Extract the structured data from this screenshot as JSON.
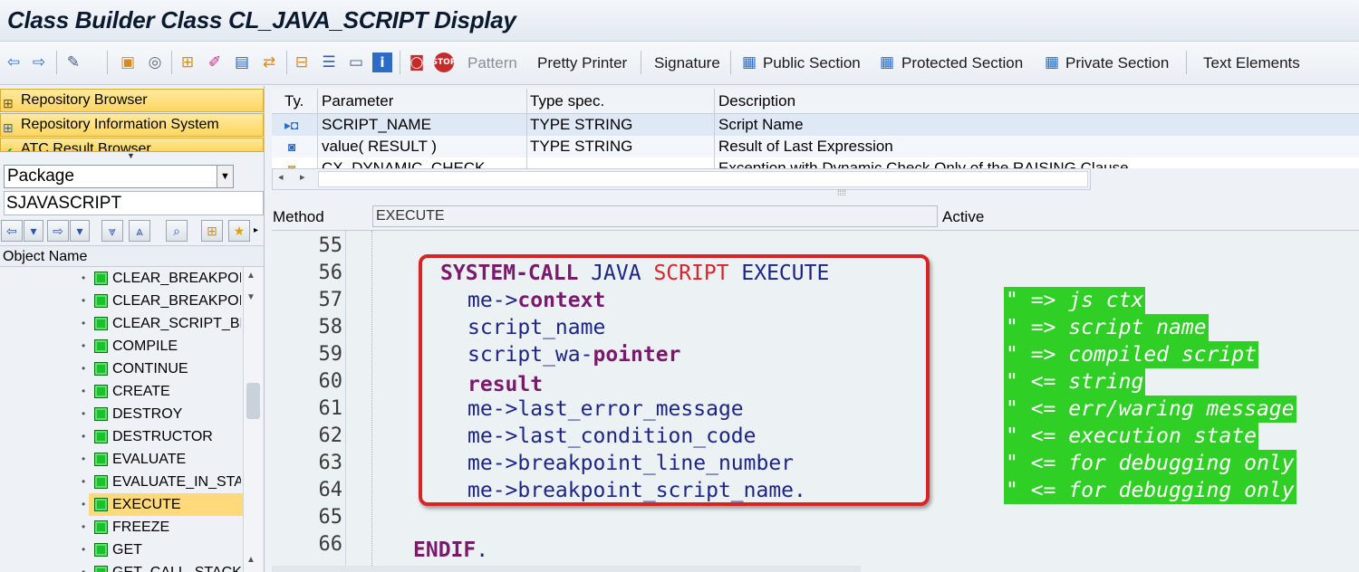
{
  "window": {
    "title": "Class Builder Class CL_JAVA_SCRIPT Display"
  },
  "toolbar": {
    "icons": [
      "back-icon",
      "forward-icon",
      "other-object-icon",
      "display-change-icon",
      "activate-icon",
      "check-icon",
      "where-used-icon",
      "object-list-icon",
      "navigation-window-icon",
      "local-types-icon",
      "info-icon",
      "set-breakpoint-icon",
      "stop-icon"
    ],
    "pattern_label": "Pattern",
    "pretty_printer_label": "Pretty Printer",
    "signature_label": "Signature",
    "public_section_label": "Public Section",
    "protected_section_label": "Protected Section",
    "private_section_label": "Private Section",
    "text_elements_label": "Text Elements"
  },
  "nav": {
    "buttons": [
      {
        "label": "Repository Browser"
      },
      {
        "label": "Repository Information System"
      },
      {
        "label": "ATC Result Browser"
      }
    ],
    "package_select": "Package",
    "package_value": "SJAVASCRIPT",
    "object_name_header": "Object Name",
    "tree_items": [
      {
        "label": "CLEAR_BREAKPOINT"
      },
      {
        "label": "CLEAR_BREAKPOINTS"
      },
      {
        "label": "CLEAR_SCRIPT_BREAKPOINTS"
      },
      {
        "label": "COMPILE"
      },
      {
        "label": "CONTINUE"
      },
      {
        "label": "CREATE"
      },
      {
        "label": "DESTROY"
      },
      {
        "label": "DESTRUCTOR"
      },
      {
        "label": "EVALUATE"
      },
      {
        "label": "EVALUATE_IN_STACK"
      },
      {
        "label": "EXECUTE"
      },
      {
        "label": "FREEZE"
      },
      {
        "label": "GET"
      },
      {
        "label": "GET_CALL_STACK"
      }
    ],
    "selected_item": "EXECUTE"
  },
  "params": {
    "headers": {
      "type": "Ty.",
      "parameter": "Parameter",
      "type_spec": "Type spec.",
      "description": "Description"
    },
    "rows": [
      {
        "parameter": "SCRIPT_NAME",
        "type_spec": "TYPE STRING",
        "description": "Script Name"
      },
      {
        "parameter": "value( RESULT )",
        "type_spec": "TYPE STRING",
        "description": "Result of Last Expression"
      },
      {
        "parameter": "CX_DYNAMIC_CHECK",
        "type_spec": "",
        "description": "Exception with Dynamic Check Only of the RAISING Clause"
      }
    ]
  },
  "method": {
    "label": "Method",
    "name": "EXECUTE",
    "status": "Active"
  },
  "editor": {
    "line_numbers": [
      "55",
      "56",
      "57",
      "58",
      "59",
      "60",
      "61",
      "62",
      "63",
      "64",
      "65",
      "66"
    ],
    "lines": {
      "l56_kw": "SYSTEM-CALL",
      "l56_java": "JAVA",
      "l56_script": "SCRIPT",
      "l56_execute": "EXECUTE",
      "l57_prefix": "me->",
      "l57_kw": "context",
      "l58": "script_name",
      "l59_prefix": "script_wa-",
      "l59_kw": "pointer",
      "l60_kw": "result",
      "l61": "me->last_error_message",
      "l62": "me->last_condition_code",
      "l63": "me->breakpoint_line_number",
      "l64": "me->breakpoint_script_name.",
      "l66_kw": "ENDIF",
      "l66_dot": "."
    },
    "comments": [
      "\" => js ctx",
      "\" => script name",
      "\" => compiled script",
      "\" <= string",
      "\" <= err/waring message",
      "\" <= execution state",
      "\" <= for debugging only",
      "\" <= for debugging only"
    ],
    "colors": {
      "keyword": "#7a1a6c",
      "identifier": "#1c2585",
      "literal_red": "#d7262b",
      "comment_bg": "#2fcf26",
      "highlight_box": "#d92424"
    }
  }
}
